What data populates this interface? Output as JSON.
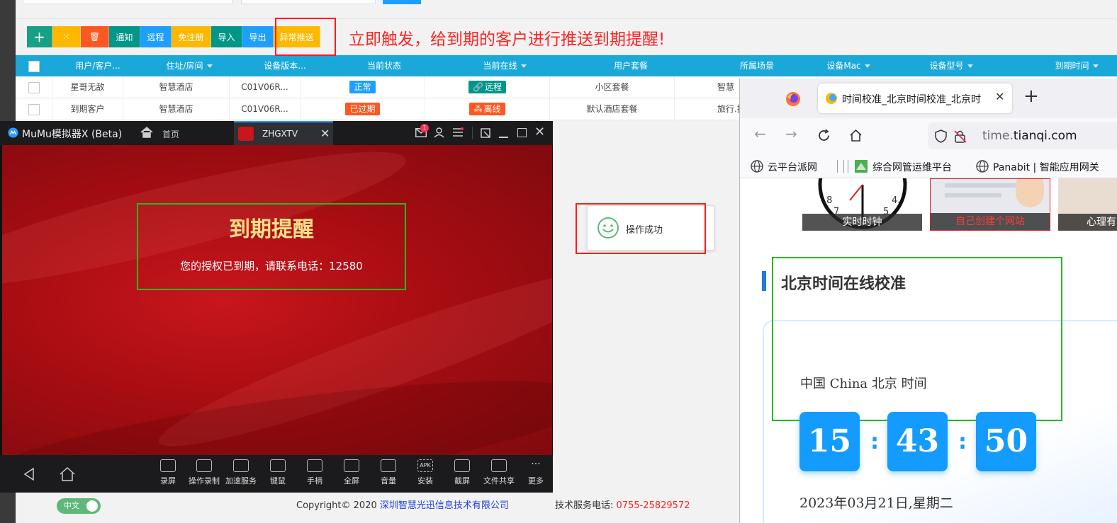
{
  "toolbar": {
    "buttons": [
      {
        "label": "+",
        "color": "#16a085",
        "width": 36
      },
      {
        "label": "⁙",
        "color": "#ffb800",
        "width": 40
      },
      {
        "label": "🗑",
        "color": "#ff5722",
        "width": 40
      },
      {
        "label": "通知",
        "color": "#009688",
        "width": 44
      },
      {
        "label": "远程",
        "color": "#1e9fff",
        "width": 44
      },
      {
        "label": "免注册",
        "color": "#ffb800",
        "width": 56
      },
      {
        "label": "导入",
        "color": "#009688",
        "width": 44
      },
      {
        "label": "导出",
        "color": "#1e9fff",
        "width": 44
      },
      {
        "label": "异常推送",
        "color": "#ffb800",
        "width": 66
      }
    ]
  },
  "annotation": {
    "text": "立即触发，给到期的客户进行推送到期提醒!"
  },
  "table": {
    "headers": [
      "用户/客户...",
      "住址/房间",
      "设备版本...",
      "当前状态",
      "当前在线",
      "用户套餐",
      "所属场景",
      "设备Mac",
      "设备型号",
      "到期时间"
    ],
    "rows": [
      {
        "user": "星哥无敌",
        "address": "智慧酒店",
        "version": "C01V06R...",
        "status": "正常",
        "status_color": "#1e9fff",
        "online": "远程",
        "online_color": "#009688",
        "online_icon": "link-icon",
        "package": "小区套餐",
        "scene": "智慧"
      },
      {
        "user": "到期客户",
        "address": "智慧酒店",
        "version": "C01V06R...",
        "status": "已过期",
        "status_color": "#ff5722",
        "online": "离线",
        "online_color": "#ff5722",
        "online_icon": "offline-icon",
        "package": "默认酒店套餐",
        "scene": "旅行.探"
      }
    ]
  },
  "toast": {
    "message": "操作成功"
  },
  "footer": {
    "lang": "中文",
    "copyright": "Copyright© 2020",
    "company": "深圳智慧光迅信息技术有限公司",
    "support_label": "技术服务电话:",
    "support_phone": "0755-25829572"
  },
  "emulator": {
    "title": "MuMu模拟器X (Beta)",
    "home_label": "首页",
    "tab_label": "ZHGXTV",
    "mail_badge": "1",
    "dialog_title": "到期提醒",
    "dialog_message": "您的授权已到期，请联系电话：12580",
    "bottom_tools": [
      "录屏",
      "操作录制",
      "加速服务",
      "键鼠",
      "手柄",
      "全屏",
      "音量",
      "安装",
      "截屏",
      "文件共享",
      "更多"
    ],
    "install_icon_text": "APK"
  },
  "browser": {
    "tab_title": "时间校准_北京时间校准_北京时",
    "url_domain": "time.",
    "url_rest": "tianqi.com",
    "bookmarks": [
      "云平台派网",
      "综合网管运维平台",
      "Panabit | 智能应用网关"
    ],
    "thumbs": [
      "实时时钟",
      "自己创建个网站",
      "心理有"
    ],
    "clock_face_numbers": [
      ".8",
      "7",
      "5",
      "4."
    ],
    "section_title": "北京时间在线校准",
    "location_line": "中国 China 北京 时间",
    "hour": "15",
    "minute": "43",
    "second": "50",
    "date_line": "2023年03月21日,星期二"
  }
}
